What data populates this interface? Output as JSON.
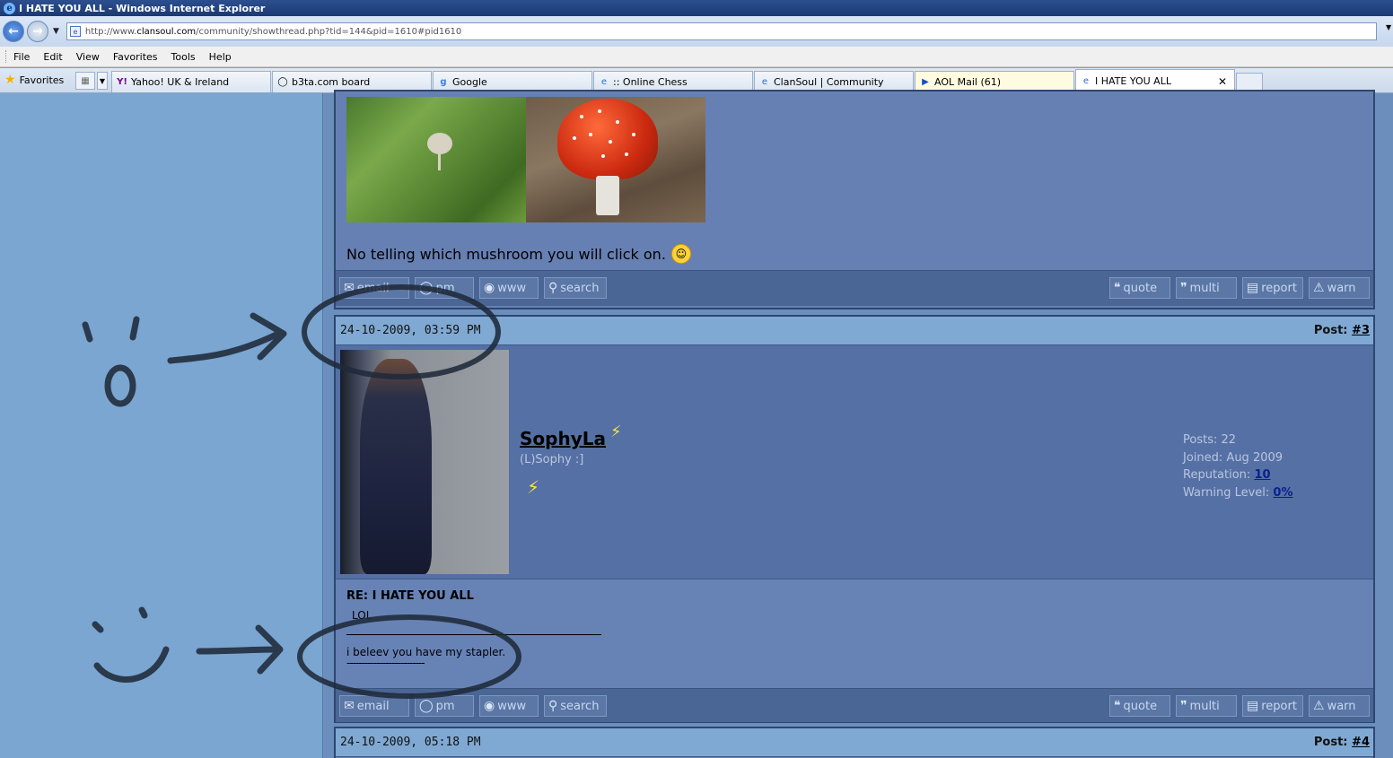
{
  "window": {
    "title": "I HATE YOU ALL - Windows Internet Explorer"
  },
  "address": {
    "url_prefix": "http://www.",
    "url_domain": "clansoul.com",
    "url_suffix": "/community/showthread.php?tid=144&pid=1610#pid1610"
  },
  "menu": [
    "File",
    "Edit",
    "View",
    "Favorites",
    "Tools",
    "Help"
  ],
  "favorites_label": "Favorites",
  "tabs": [
    {
      "label": "Yahoo! UK & Ireland",
      "icon": "yahoo-icon"
    },
    {
      "label": "b3ta.com board",
      "icon": "b3ta-icon"
    },
    {
      "label": "Google",
      "icon": "google-icon"
    },
    {
      "label": ":: Online Chess",
      "icon": "ie-page-icon"
    },
    {
      "label": "ClanSoul | Community",
      "icon": "ie-page-icon"
    },
    {
      "label": "AOL Mail (61)",
      "icon": "aol-icon"
    },
    {
      "label": "I HATE YOU ALL",
      "icon": "ie-page-icon",
      "active": true
    }
  ],
  "post1": {
    "text": "No telling which mushroom you will click on."
  },
  "actions": {
    "email": "email",
    "pm": "pm",
    "www": "www",
    "search": "search",
    "quote": "quote",
    "multi": "multi",
    "report": "report",
    "warn": "warn"
  },
  "post2": {
    "datetime": "24-10-2009, 03:59 PM",
    "post_label": "Post:",
    "post_number": "#3",
    "username": "SophyLa",
    "usertitle": "(L)Sophy :]",
    "stats": {
      "posts_label": "Posts:",
      "posts": "22",
      "joined_label": "Joined:",
      "joined": "Aug 2009",
      "reputation_label": "Reputation:",
      "reputation": "10",
      "warning_label": "Warning Level:",
      "warning": "0%"
    },
    "subject": "RE: I HATE YOU ALL",
    "message": "LOL",
    "signature_line1": "i beleev you have my stapler.",
    "signature_line2": "--------------------------"
  },
  "post3": {
    "datetime": "24-10-2009, 05:18 PM",
    "post_label": "Post:",
    "post_number": "#4"
  },
  "colors": {
    "accent": "#1c3a73",
    "page_bg": "#7aa6d1",
    "post_bg": "#6680b3",
    "header_bg": "#7fa9d3",
    "annotation_ink": "#1f2a3a"
  }
}
